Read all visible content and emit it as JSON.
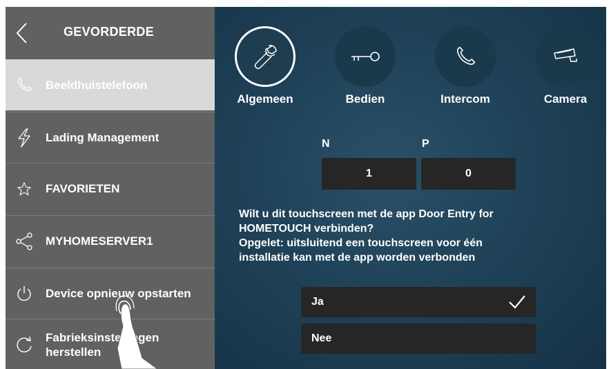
{
  "sidebar": {
    "title": "GEVORDERDE",
    "items": [
      {
        "label": "Beeldhuistelefoon",
        "icon": "phone-icon",
        "active": true
      },
      {
        "label": "Lading Management",
        "icon": "lightning-icon"
      },
      {
        "label": "FAVORIETEN",
        "icon": "star-icon"
      },
      {
        "label": "MYHOMESERVER1",
        "icon": "share-icon"
      },
      {
        "label": "Device opnieuw opstarten",
        "icon": "power-icon"
      },
      {
        "label": "Fabrieksinstellingen herstellen",
        "icon": "reset-icon"
      }
    ]
  },
  "tabs": [
    {
      "label": "Algemeen",
      "icon": "wrench-icon",
      "active": true
    },
    {
      "label": "Bedien",
      "icon": "key-icon"
    },
    {
      "label": "Intercom",
      "icon": "phone-icon"
    },
    {
      "label": "Camera",
      "icon": "camera-icon"
    }
  ],
  "address": {
    "n_label": "N",
    "p_label": "P",
    "n_value": "1",
    "p_value": "0"
  },
  "question": {
    "line1": "Wilt u dit touchscreen met de app Door Entry for",
    "line2": "HOMETOUCH verbinden?",
    "line3": "Opgelet: uitsluitend een touchscreen voor één",
    "line4": "installatie kan met de app worden verbonden"
  },
  "options": [
    {
      "label": "Ja",
      "selected": true
    },
    {
      "label": "Nee",
      "selected": false
    }
  ],
  "colors": {
    "sidebar_bg": "#5f6163",
    "sidebar_active": "#d9d9d9",
    "main_bg": "#1f4258",
    "box_bg": "#262626",
    "text": "#ffffff"
  }
}
